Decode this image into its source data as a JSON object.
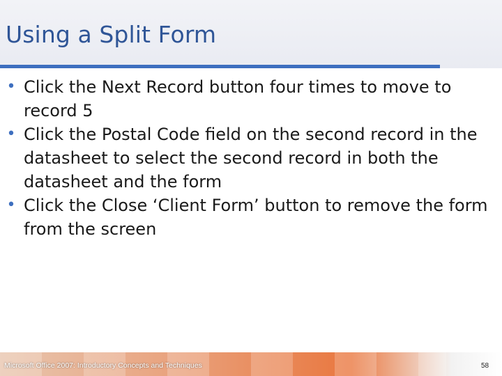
{
  "slide": {
    "title": "Using a Split Form",
    "bullets": [
      "Click the Next Record button four times to move to record 5",
      "Click the Postal Code field on the second record in the datasheet to select the second record in both the datasheet and the form",
      "Click the Close ‘Client Form’ button to remove the form from the screen"
    ],
    "bullet_glyph": "•",
    "footer_text": "Microsoft Office 2007: Introductory Concepts and Techniques",
    "page_number": "58"
  },
  "colors": {
    "title": "#2f5597",
    "accent": "#3e6fbf",
    "footer": "#e9773f"
  }
}
